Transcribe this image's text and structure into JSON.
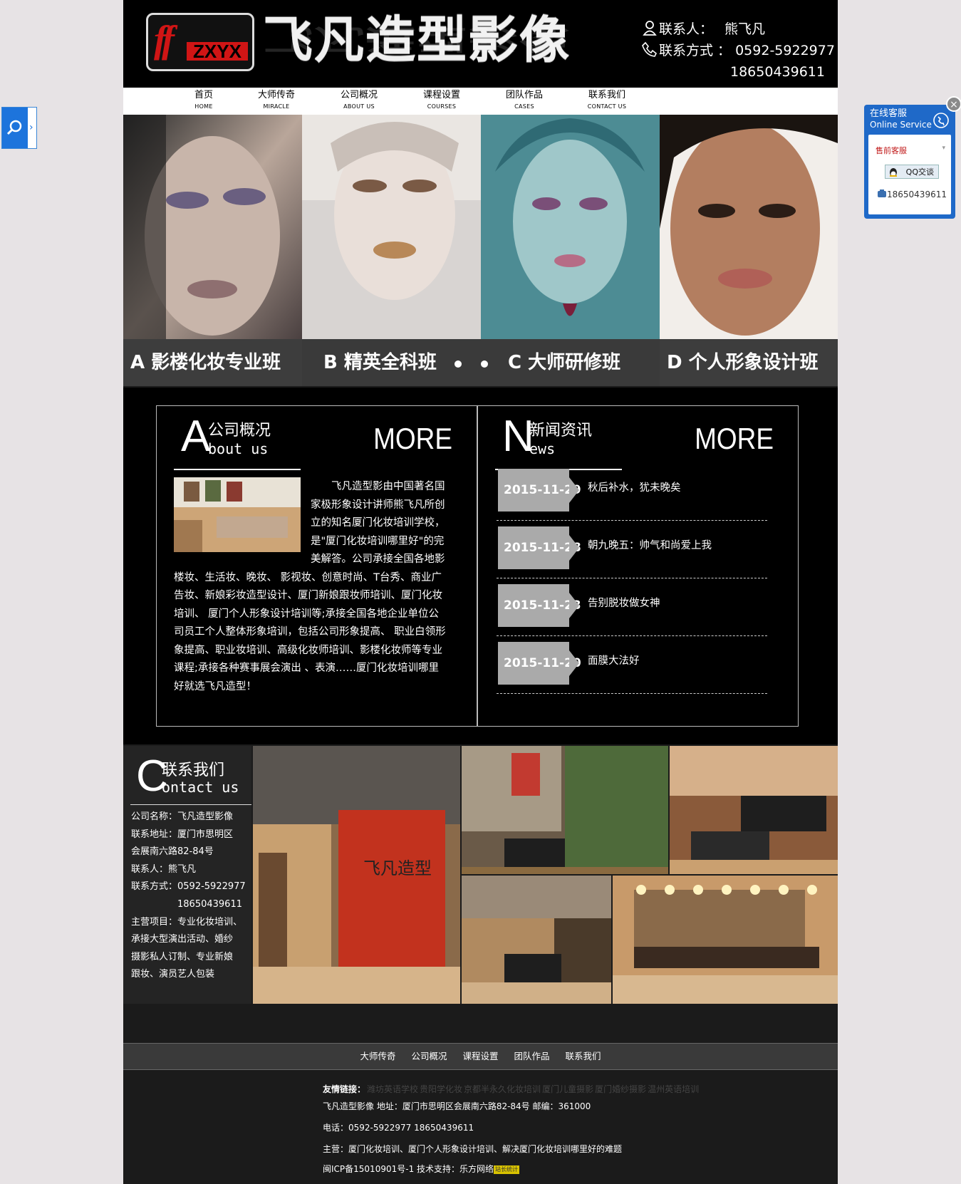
{
  "header": {
    "logo_ff": "ff",
    "logo_zxyx": "ZXYX",
    "brand": "飞凡造型影像",
    "contact_person_label": "联系人：",
    "contact_person": "熊飞凡",
    "contact_method_label": "联系方式 ：",
    "phone1": "0592-5922977",
    "phone2": "18650439611"
  },
  "nav": [
    {
      "cn": "首页",
      "en": "HOME"
    },
    {
      "cn": "大师传奇",
      "en": "MIRACLE"
    },
    {
      "cn": "公司概况",
      "en": "ABOUT US"
    },
    {
      "cn": "课程设置",
      "en": "COURSES"
    },
    {
      "cn": "团队作品",
      "en": "CASES"
    },
    {
      "cn": "联系我们",
      "en": "CONTACT US"
    }
  ],
  "banner": {
    "classes": [
      "A  影楼化妆专业班",
      "B  精英全科班",
      "C  大师研修班",
      "D  个人形象设计班"
    ]
  },
  "about": {
    "letter": "A",
    "title_cn": "公司概况",
    "title_en": "bout us",
    "more": "MORE",
    "text": "　　飞凡造型影由中国著名国家极形象设计讲师熊飞凡所创立的知名厦门化妆培训学校，是\"厦门化妆培训哪里好\"的完美解答。公司承接全国各地影楼妆、生活妆、晚妆、 影视妆、创意时尚、T台秀、商业广告妆、新娘彩妆造型设计、厦门新娘跟妆师培训、厦门化妆培训、 厦门个人形象设计培训等;承接全国各地企业单位公司员工个人整体形象培训，包括公司形象提高、 职业白领形象提高、职业妆培训、高级化妆师培训、影楼化妆师等专业课程;承接各种赛事展会演出 、表演……厦门化妆培训哪里好就选飞凡造型！"
  },
  "news": {
    "letter": "N",
    "title_cn": "新闻资讯",
    "title_en": "ews",
    "more": "MORE",
    "items": [
      {
        "date": "2015-11-29",
        "title": "秋后补水，犹未晚矣"
      },
      {
        "date": "2015-11-28",
        "title": "朝九晚五：帅气和尚爱上我"
      },
      {
        "date": "2015-11-23",
        "title": "告别脱妆做女神"
      },
      {
        "date": "2015-11-20",
        "title": "面膜大法好"
      }
    ]
  },
  "contact": {
    "letter": "C",
    "title_cn": "联系我们",
    "title_en": "ontact us",
    "lines": [
      "公司名称：飞凡造型影像",
      "联系地址：厦门市思明区",
      "会展南六路82-84号",
      "联系人：熊飞凡",
      "联系方式：0592-5922977",
      "　　　　　18650439611",
      "主营项目：专业化妆培训、",
      "承接大型演出活动、婚纱",
      "摄影私人订制、专业新娘",
      "跟妆、演员艺人包装"
    ],
    "wall_sign": "飞凡造型"
  },
  "footer": {
    "nav": [
      "大师传奇",
      "公司概况",
      "课程设置",
      "团队作品",
      "联系我们"
    ],
    "links_label": "友情链接：",
    "links": [
      "潍坊英语学校",
      "贵阳学化妆",
      "京都半永久化妆培训",
      "厦门儿童摄影",
      "厦门婚纱摄影",
      "温州英语培训"
    ],
    "address": "飞凡造型影像 地址：厦门市思明区会展南六路82-84号 邮编：361000",
    "phone": "电话：0592-5922977 18650439611",
    "business": "主营：厦门化妆培训、厦门个人形象设计培训、解决厦门化妆培训哪里好的难题",
    "icp": "闽ICP备15010901号-1 技术支持：乐方网络",
    "badge": "站长统计"
  },
  "service": {
    "title_cn": "在线客服",
    "title_en": "Online Service",
    "group": "售前客服",
    "qq_button": "QQ交谈",
    "phone": "18650439611"
  },
  "colors": {
    "logo_red": "#d01515",
    "service_blue": "#1f69c8",
    "search_blue": "#1d74dc",
    "news_date_bg": "#aaaaaa"
  }
}
